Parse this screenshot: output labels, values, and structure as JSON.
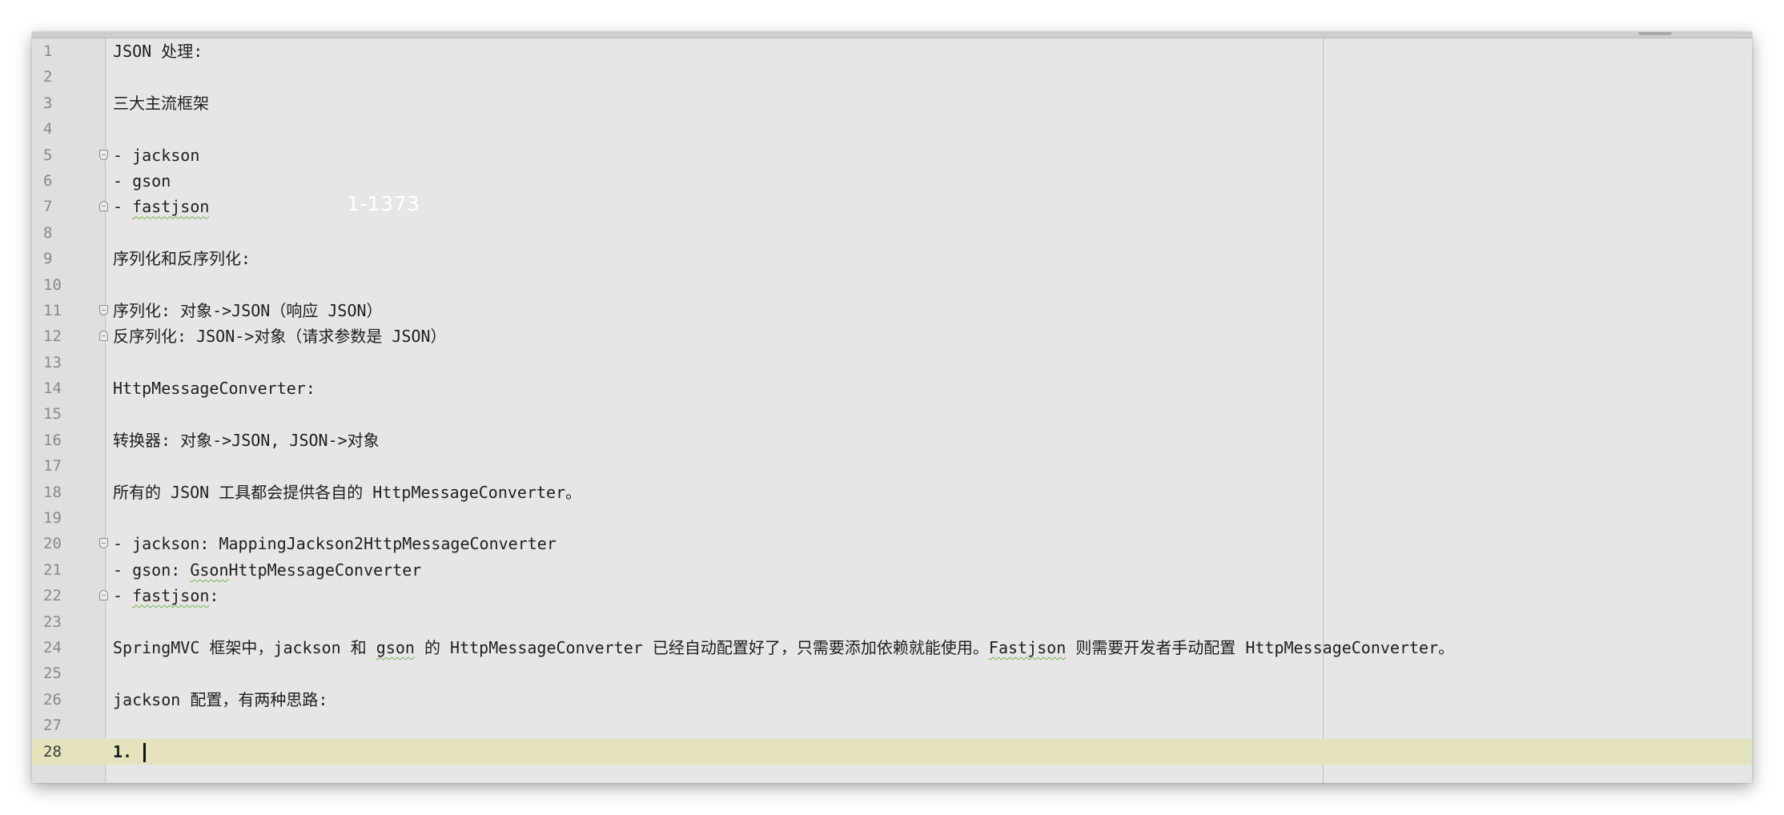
{
  "editor": {
    "watermark": "1-1373",
    "current_line": 28,
    "lines": [
      {
        "num": "1",
        "text": "JSON 处理:"
      },
      {
        "num": "2",
        "text": ""
      },
      {
        "num": "3",
        "text": "三大主流框架"
      },
      {
        "num": "4",
        "text": ""
      },
      {
        "num": "5",
        "text": "- jackson"
      },
      {
        "num": "6",
        "text": "- gson"
      },
      {
        "num": "7",
        "pre": "- ",
        "sq": "fastjson"
      },
      {
        "num": "8",
        "text": ""
      },
      {
        "num": "9",
        "text": "序列化和反序列化:"
      },
      {
        "num": "10",
        "text": ""
      },
      {
        "num": "11",
        "text": "序列化: 对象->JSON（响应 JSON）"
      },
      {
        "num": "12",
        "text": "反序列化: JSON->对象（请求参数是 JSON）"
      },
      {
        "num": "13",
        "text": ""
      },
      {
        "num": "14",
        "text": "HttpMessageConverter:"
      },
      {
        "num": "15",
        "text": ""
      },
      {
        "num": "16",
        "text": "转换器: 对象->JSON, JSON->对象"
      },
      {
        "num": "17",
        "text": ""
      },
      {
        "num": "18",
        "text": "所有的 JSON 工具都会提供各自的 HttpMessageConverter。"
      },
      {
        "num": "19",
        "text": ""
      },
      {
        "num": "20",
        "text": "- jackson: MappingJackson2HttpMessageConverter"
      },
      {
        "num": "21",
        "pre": "- gson: ",
        "sq": "Gson",
        "post": "HttpMessageConverter"
      },
      {
        "num": "22",
        "pre": "- ",
        "sq": "fastjson",
        "post": ":"
      },
      {
        "num": "23",
        "text": ""
      },
      {
        "num": "24",
        "pre": "SpringMVC 框架中，jackson 和 ",
        "sq": "gson",
        "post": " 的 HttpMessageConverter 已经自动配置好了，只需要添加依赖就能使用。",
        "sq2": "Fastjson",
        "post2": " 则需要开发者手动配置 HttpMessageConverter。"
      },
      {
        "num": "25",
        "text": ""
      },
      {
        "num": "26",
        "text": "jackson 配置，有两种思路:"
      },
      {
        "num": "27",
        "text": ""
      },
      {
        "num": "28",
        "text": "1. "
      }
    ]
  }
}
